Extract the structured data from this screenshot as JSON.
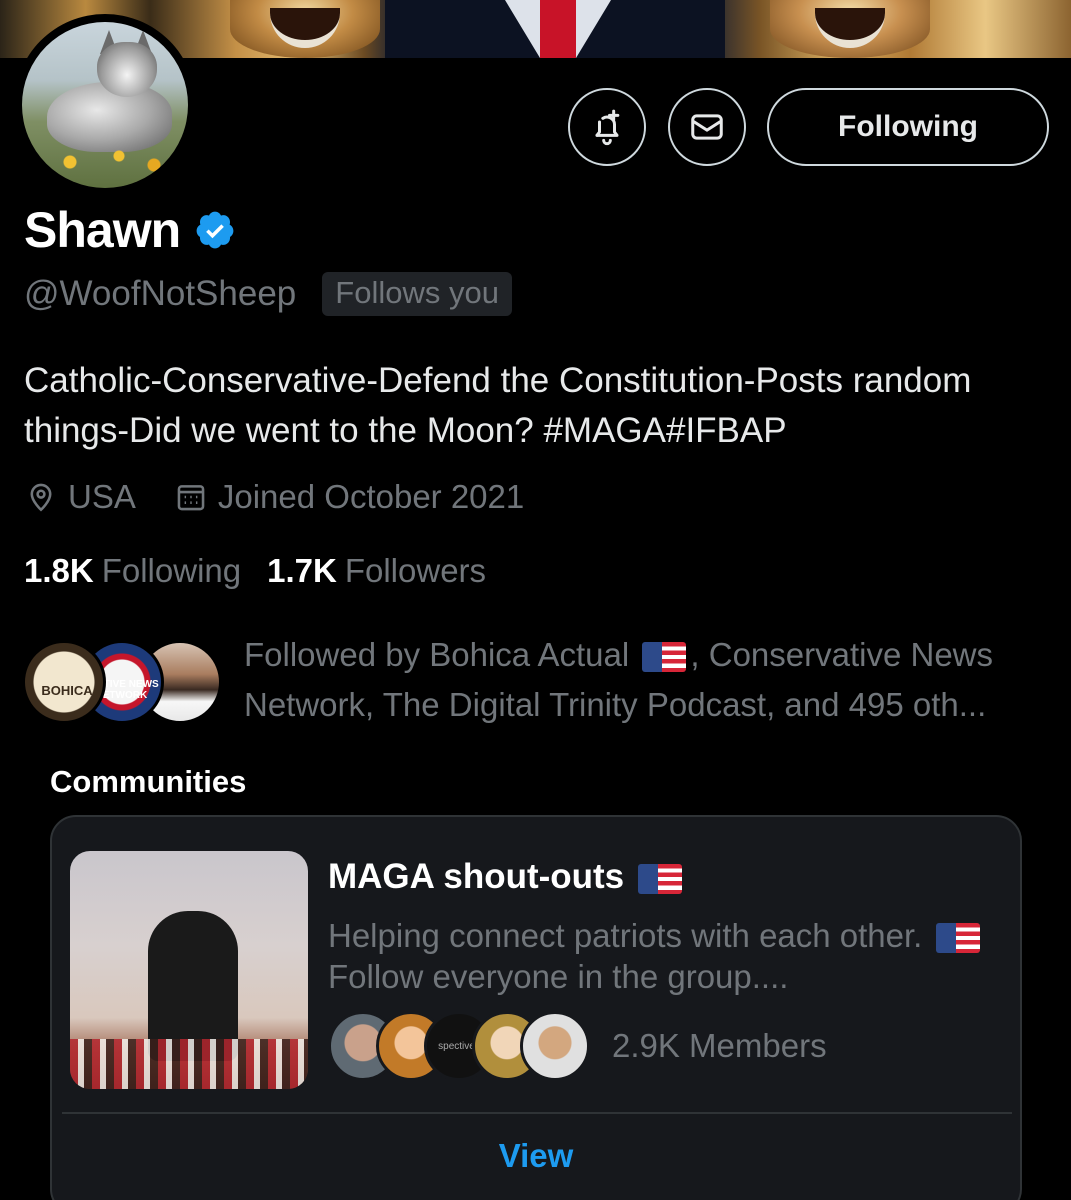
{
  "profile": {
    "display_name": "Shawn",
    "handle": "@WoofNotSheep",
    "follows_you": "Follows you",
    "bio": "Catholic-Conservative-Defend the Constitution-Posts random things-Did we went to the Moon? #MAGA#IFBAP",
    "location": "USA",
    "joined": "Joined October 2021",
    "following_count": "1.8K",
    "following_label": "Following",
    "followers_count": "1.7K",
    "followers_label": "Followers"
  },
  "actions": {
    "follow_label": "Following",
    "notify_icon": "bell-plus-icon",
    "message_icon": "envelope-icon"
  },
  "followed_by": {
    "prefix": "Followed by Bohica Actual",
    "rest": ", Conservative News Network, The Digital Trinity Podcast, and 495 oth...",
    "avatar_labels": [
      "BOHICA",
      "VATIVE NEWS ETWORK"
    ]
  },
  "communities": {
    "title": "Communities",
    "card": {
      "name": "MAGA shout-outs",
      "desc_part1": "Helping connect patriots with each other.",
      "desc_part2": "Follow everyone in the group....",
      "members": "2.9K Members",
      "member_avatar_text": "spectives",
      "view_label": "View"
    }
  },
  "colors": {
    "background": "#000000",
    "text": "#e7e9ea",
    "muted": "#71767b",
    "accent": "#1d9bf0",
    "border": "#2f3336"
  }
}
